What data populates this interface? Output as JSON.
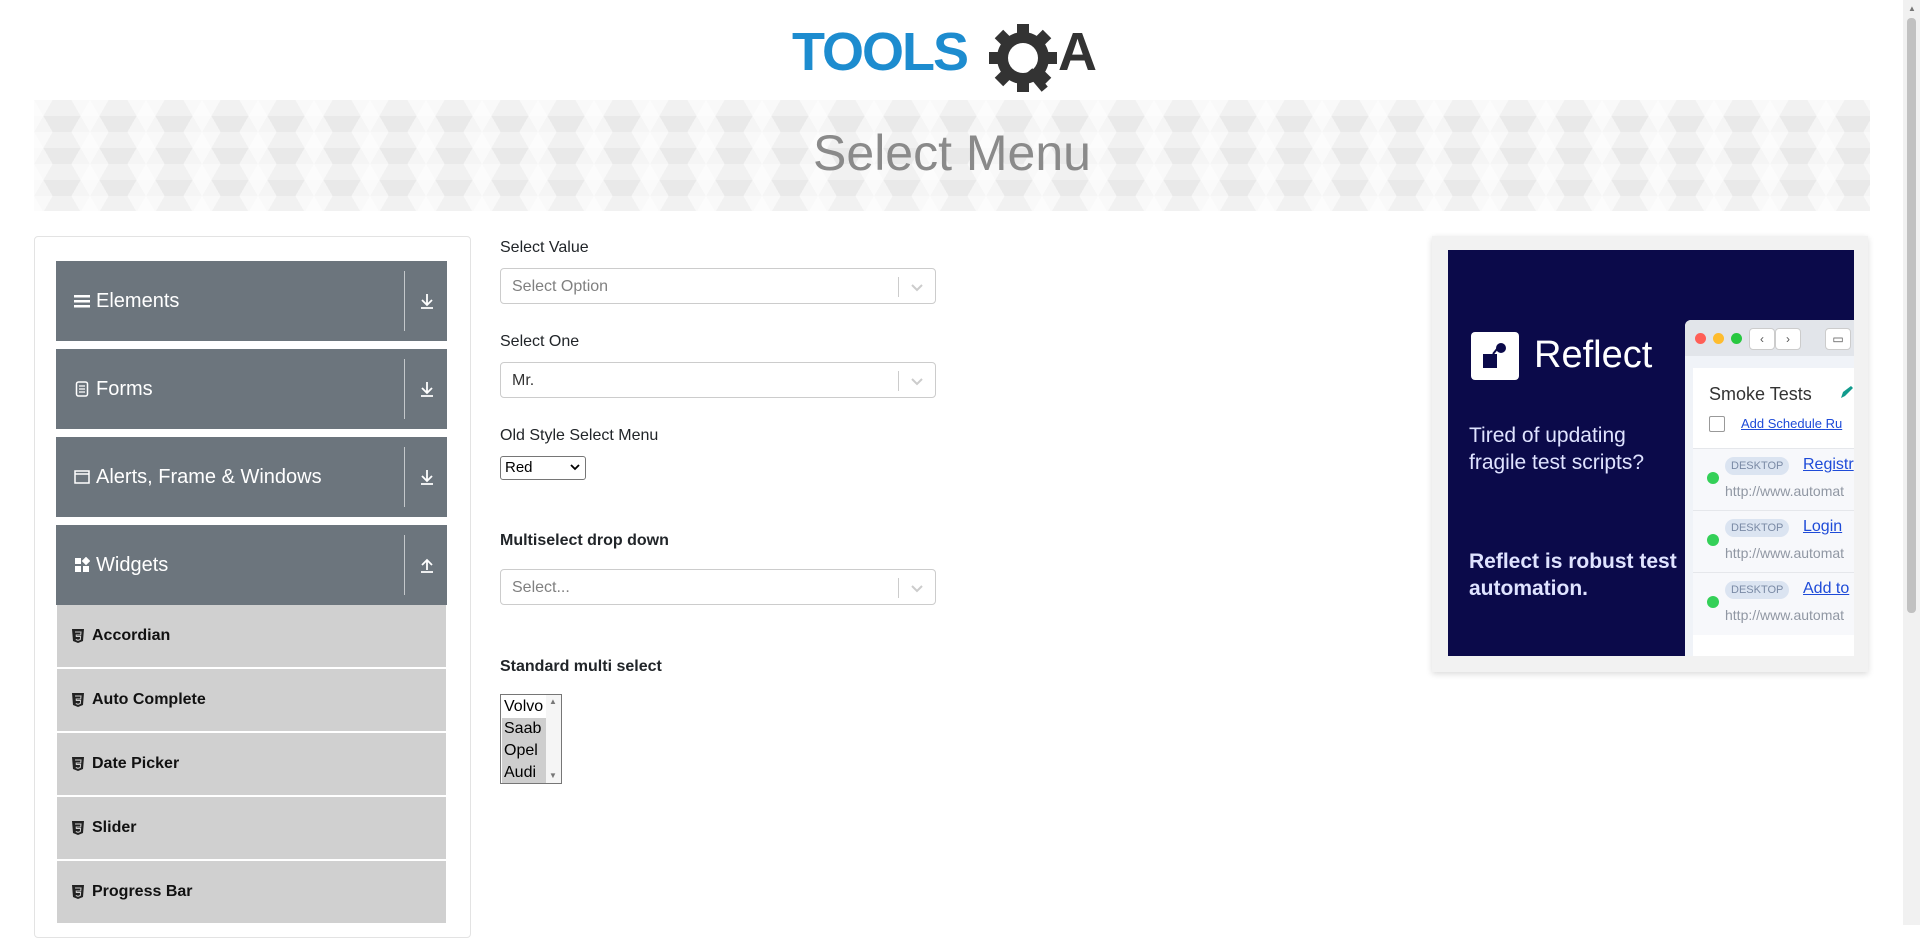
{
  "header": {
    "logo_text": "TOOLSQA"
  },
  "banner": {
    "title": "Select Menu"
  },
  "sidebar": {
    "groups": [
      {
        "label": "Elements",
        "icon": "hamburger-icon",
        "state": "collapsed"
      },
      {
        "label": "Forms",
        "icon": "document-icon",
        "state": "collapsed"
      },
      {
        "label": "Alerts, Frame & Windows",
        "icon": "window-icon",
        "state": "collapsed"
      },
      {
        "label": "Widgets",
        "icon": "widgets-icon",
        "state": "expanded"
      }
    ],
    "widget_items": [
      {
        "label": "Accordian"
      },
      {
        "label": "Auto Complete"
      },
      {
        "label": "Date Picker"
      },
      {
        "label": "Slider"
      },
      {
        "label": "Progress Bar"
      }
    ]
  },
  "form": {
    "select_value": {
      "label": "Select Value",
      "placeholder": "Select Option"
    },
    "select_one": {
      "label": "Select One",
      "value": "Mr."
    },
    "old_style": {
      "label": "Old Style Select Menu",
      "value": "Red"
    },
    "multiselect": {
      "label": "Multiselect drop down",
      "placeholder": "Select..."
    },
    "standard_multi": {
      "label": "Standard multi select",
      "options": [
        "Volvo",
        "Saab",
        "Opel",
        "Audi"
      ],
      "selected": [
        "Saab",
        "Opel",
        "Audi"
      ]
    }
  },
  "ad": {
    "brand": "Reflect",
    "headline": "Tired of updating fragile test scripts?",
    "tagline": "Reflect is robust test automation.",
    "window": {
      "title": "Smoke Tests",
      "schedule_link": "Add Schedule",
      "schedule_link2": "Ru",
      "rows": [
        {
          "badge": "DESKTOP",
          "test": "Registr",
          "url": "http://www.automat"
        },
        {
          "badge": "DESKTOP",
          "test": "Login",
          "url": "http://www.automat"
        },
        {
          "badge": "DESKTOP",
          "test": "Add to",
          "url": "http://www.automat"
        }
      ]
    }
  },
  "colors": {
    "sidebar_group_bg": "#6c757d",
    "sidebar_item_bg": "#d0d0d0",
    "logo_blue": "#1d8ccf",
    "logo_dark": "#333333",
    "ad_bg": "#0b0a4a"
  }
}
